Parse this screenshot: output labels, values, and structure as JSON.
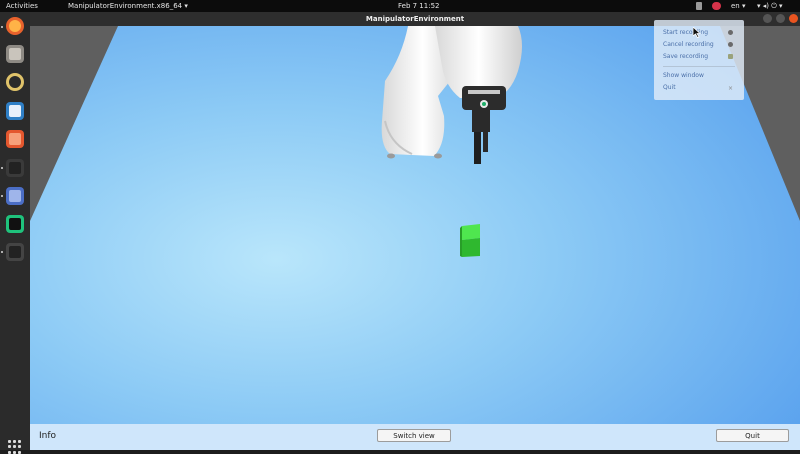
{
  "topbar": {
    "activities": "Activities",
    "app_menu": "ManipulatorEnvironment.x86_64 ▾",
    "clock": "Feb 7  11:52",
    "lang": "en ▾",
    "sys_icons": "▾  ◂)  ⏻ ▾"
  },
  "window": {
    "title": "ManipulatorEnvironment"
  },
  "bottombar": {
    "info_label": "Info",
    "switch_view_label": "Switch view",
    "quit_label": "Quit"
  },
  "menu": {
    "start_recording": "Start recording",
    "cancel_recording": "Cancel recording",
    "save_recording": "Save recording",
    "show_window": "Show window",
    "quit": "Quit"
  },
  "dock": {
    "items": [
      {
        "icon": "firefox-icon",
        "color": "#e8622c"
      },
      {
        "icon": "files-icon",
        "color": "#8e8a84"
      },
      {
        "icon": "rhythmbox-icon",
        "color": "#e0c36a"
      },
      {
        "icon": "writer-icon",
        "color": "#2f7fc6"
      },
      {
        "icon": "software-icon",
        "color": "#e4572e"
      },
      {
        "icon": "terminal-icon",
        "color": "#3a3a3a"
      },
      {
        "icon": "screenshot-icon",
        "color": "#4b6ec6"
      },
      {
        "icon": "pycharm-icon",
        "color": "#1fc27c"
      },
      {
        "icon": "unity-icon",
        "color": "#444444"
      }
    ]
  },
  "colors": {
    "floor": "#6aaef0",
    "cube": "#38cf38",
    "close": "#e95420"
  }
}
